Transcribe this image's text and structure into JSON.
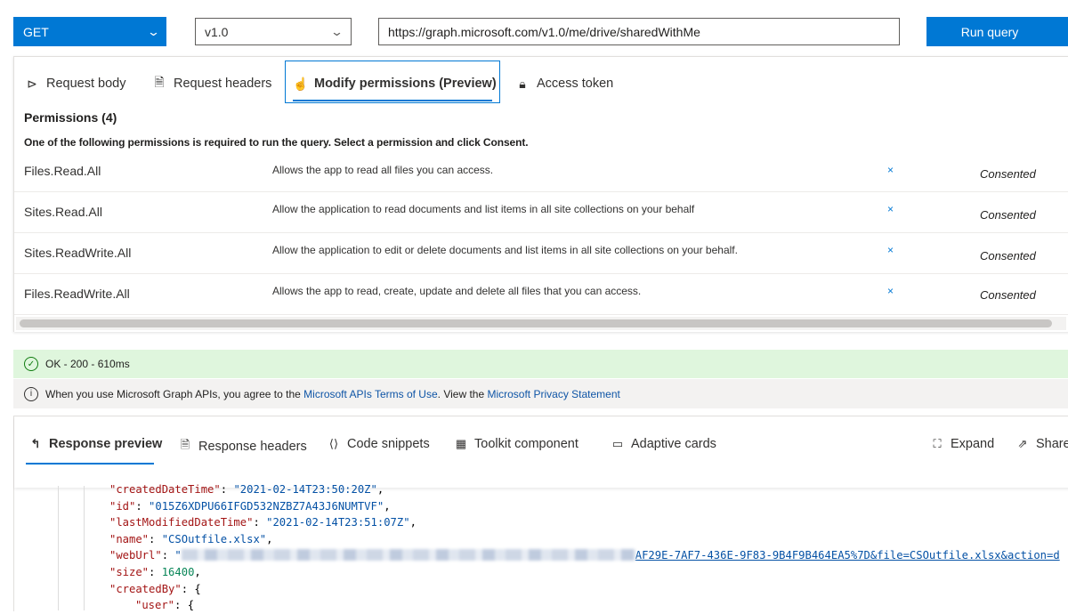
{
  "query": {
    "method": "GET",
    "version": "v1.0",
    "url": "https://graph.microsoft.com/v1.0/me/drive/sharedWithMe",
    "run_label": "Run query"
  },
  "request_tabs": [
    {
      "label": "Request body",
      "icon": "send-icon"
    },
    {
      "label": "Request headers",
      "icon": "document-icon"
    },
    {
      "label": "Modify permissions (Preview)",
      "icon": "hand-icon"
    },
    {
      "label": "Access token",
      "icon": "lock-icon"
    }
  ],
  "permissions": {
    "title": "Permissions (4)",
    "description": "One of the following permissions is required to run the query. Select a permission and click Consent.",
    "rows": [
      {
        "name": "Files.Read.All",
        "text": "Allows the app to read all files you can access.",
        "admin": "×",
        "status": "Consented"
      },
      {
        "name": "Sites.Read.All",
        "text": "Allow the application to read documents and list items in all site collections on your behalf",
        "admin": "×",
        "status": "Consented"
      },
      {
        "name": "Sites.ReadWrite.All",
        "text": "Allow the application to edit or delete documents and list items in all site collections on your behalf.",
        "admin": "×",
        "status": "Consented"
      },
      {
        "name": "Files.ReadWrite.All",
        "text": "Allows the app to read, create, update and delete all files that you can access.",
        "admin": "×",
        "status": "Consented"
      }
    ]
  },
  "status": {
    "ok_text": "OK - 200 - 610ms",
    "info_prefix": "When you use Microsoft Graph APIs, you agree to the ",
    "terms_link": "Microsoft APIs Terms of Use",
    "info_middle": ". View the ",
    "privacy_link": "Microsoft Privacy Statement",
    "close": "×"
  },
  "response_tabs": [
    {
      "label": "Response preview",
      "icon": "back-arrow-icon"
    },
    {
      "label": "Response headers",
      "icon": "document-icon"
    },
    {
      "label": "Code snippets",
      "icon": "code-icon"
    },
    {
      "label": "Toolkit component",
      "icon": "toolkit-icon"
    },
    {
      "label": "Adaptive cards",
      "icon": "card-icon"
    }
  ],
  "response_actions": {
    "expand": "Expand",
    "share": "Share"
  },
  "response_json": {
    "createdDateTime_key": "\"createdDateTime\"",
    "createdDateTime_val": "\"2021-02-14T23:50:20Z\"",
    "id_key": "\"id\"",
    "id_val": "\"015Z6XDPU66IFGD532NZBZ7A43J6NUMTVF\"",
    "lastModified_key": "\"lastModifiedDateTime\"",
    "lastModified_val": "\"2021-02-14T23:51:07Z\"",
    "name_key": "\"name\"",
    "name_val": "\"CSOutfile.xlsx\"",
    "webUrl_key": "\"webUrl\"",
    "webUrl_tail": "AF29E-7AF7-436E-9F83-9B4F9B464EA5%7D&file=CSOutfile.xlsx&action=d",
    "size_key": "\"size\"",
    "size_val": "16400",
    "createdBy_key": "\"createdBy\"",
    "user_key": "\"user\""
  }
}
